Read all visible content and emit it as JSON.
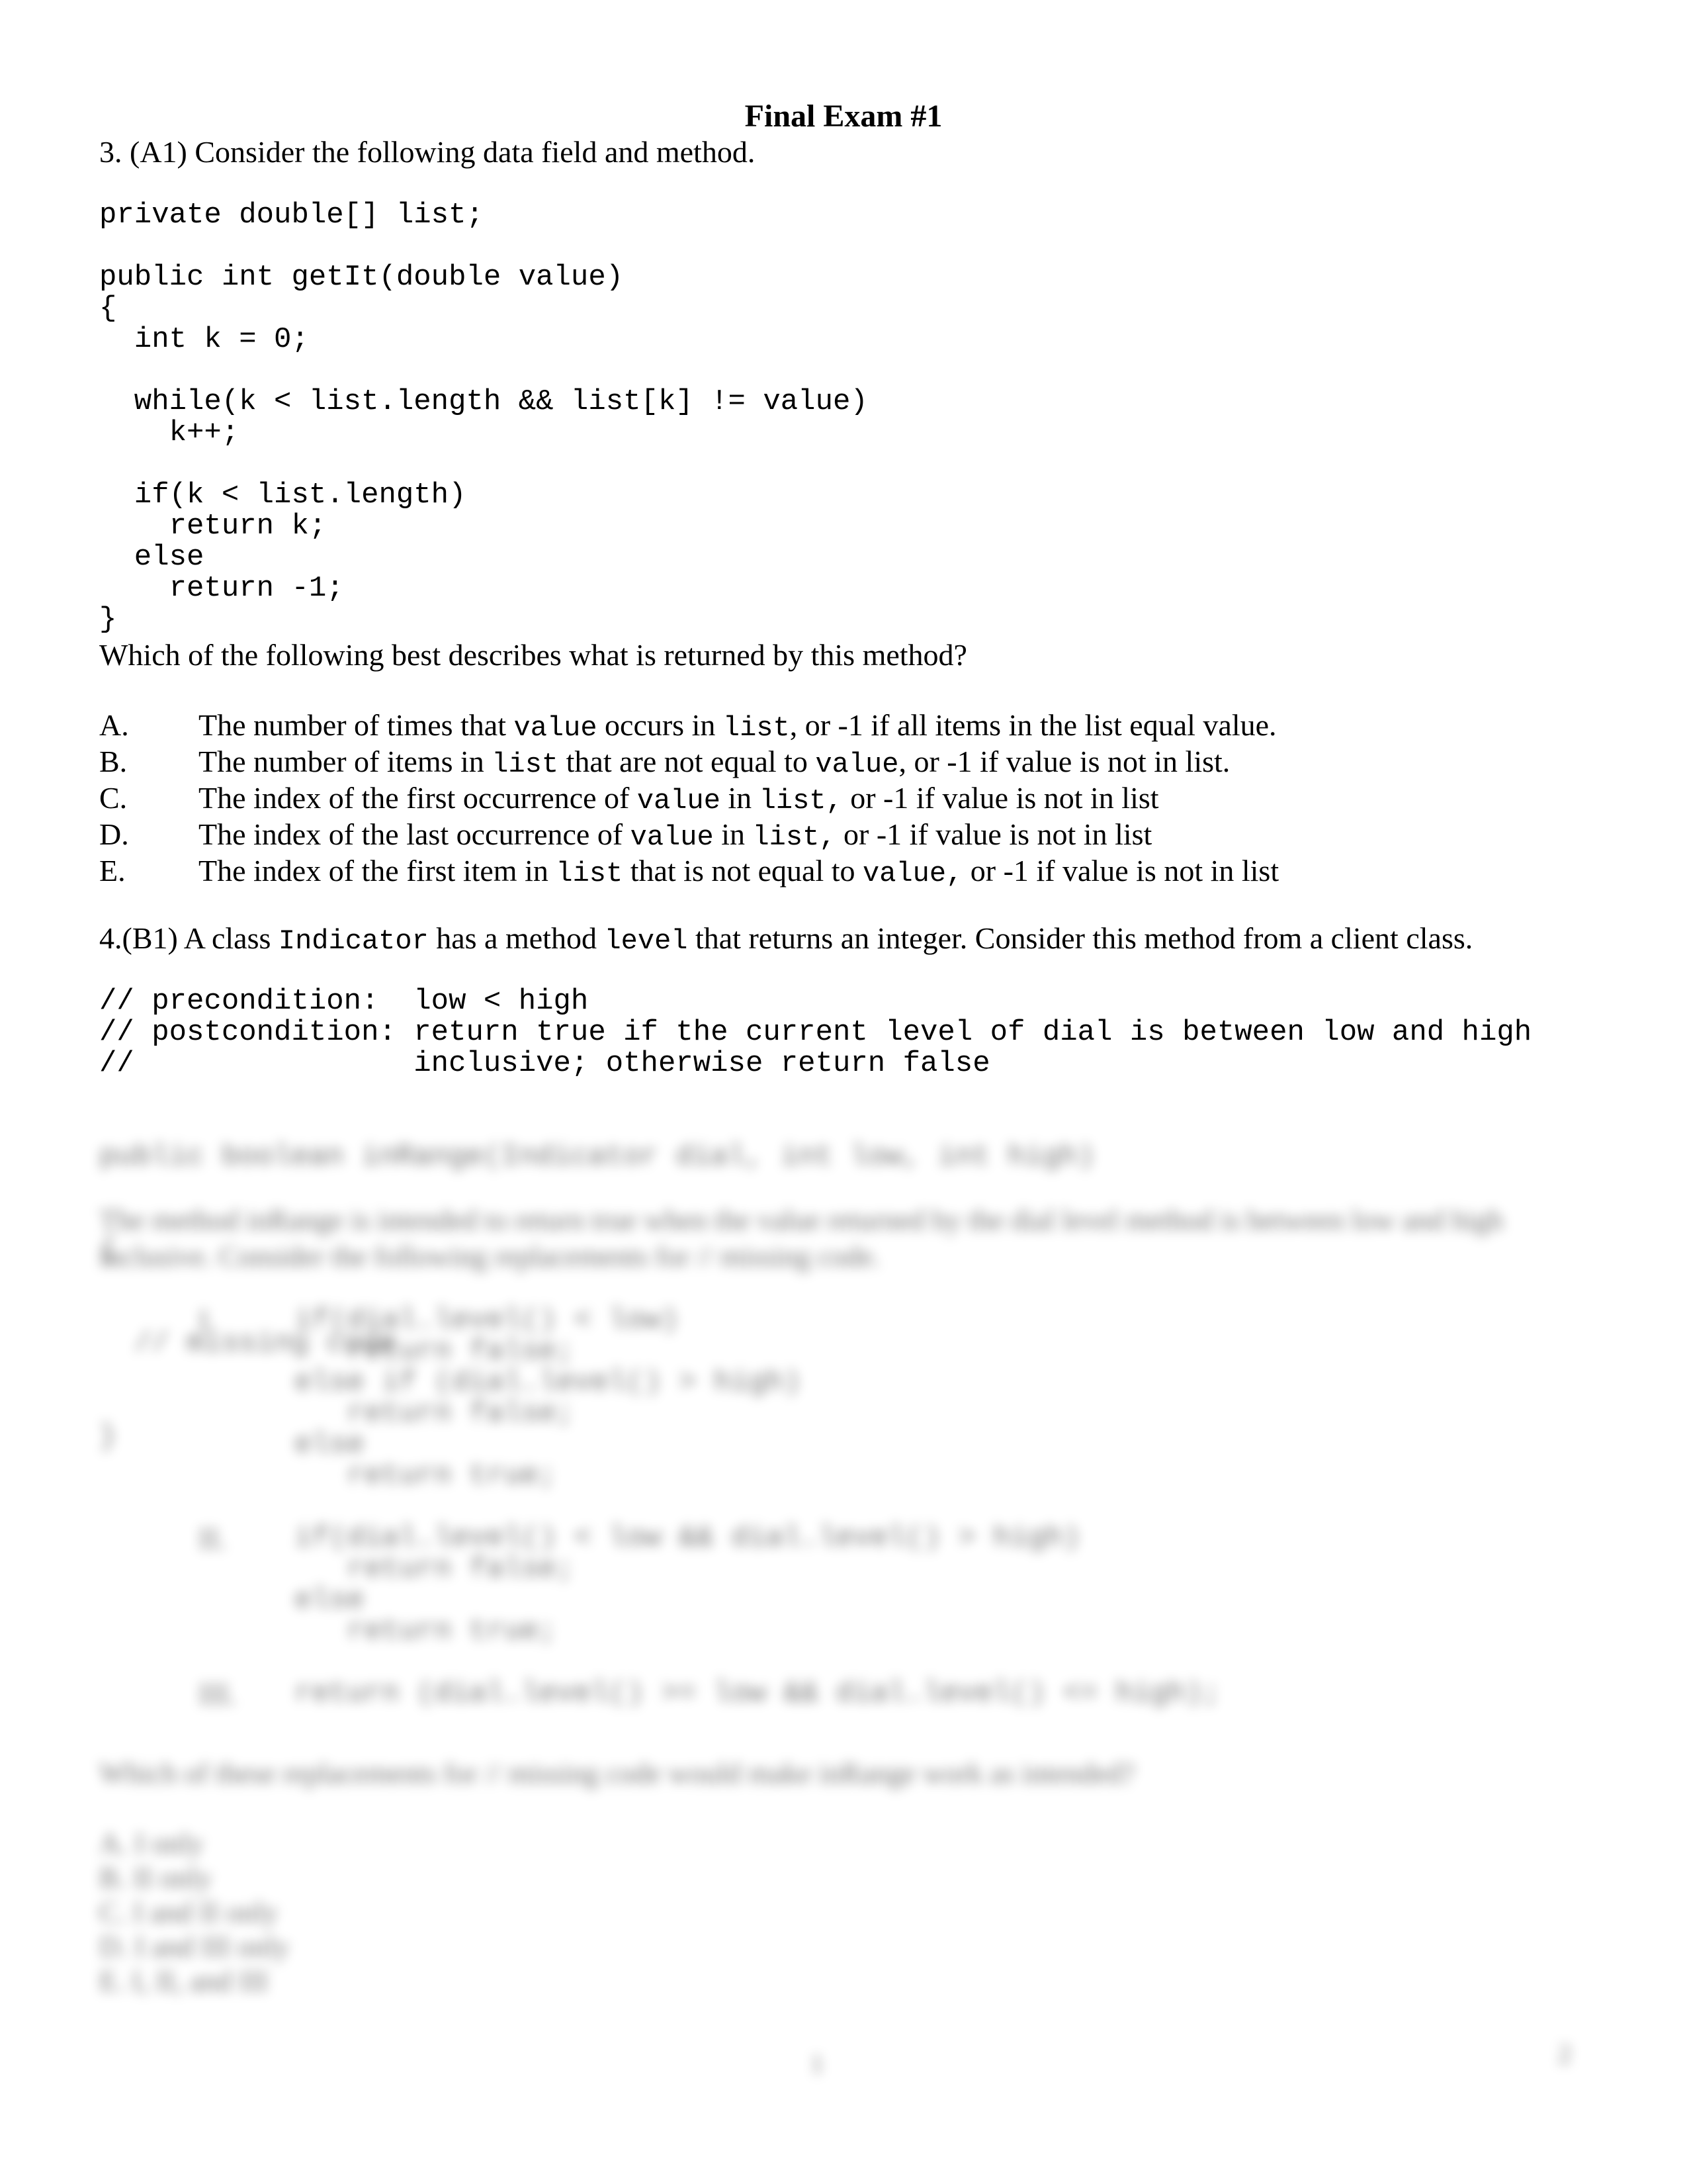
{
  "document": {
    "title": "Final Exam #1"
  },
  "q3": {
    "prompt": "3. (A1)  Consider the following data field and method.",
    "field_line": "private double[] list;",
    "code": [
      "public int getIt(double value)",
      "{",
      "  int k = 0;",
      "",
      "  while(k < list.length && list[k] != value)",
      "    k++;",
      "",
      "  if(k < list.length)",
      "    return k;",
      "  else",
      "    return -1;",
      "}"
    ],
    "question": "Which of the following best describes what is returned by this method?",
    "options": [
      {
        "letter": "A.",
        "parts": [
          {
            "t": "The number of times that ",
            "code": false
          },
          {
            "t": "value",
            "code": true
          },
          {
            "t": " occurs in ",
            "code": false
          },
          {
            "t": "list",
            "code": true
          },
          {
            "t": ", or -1 if all items in the list equal value.",
            "code": false
          }
        ]
      },
      {
        "letter": "B.",
        "parts": [
          {
            "t": "The number of items in ",
            "code": false
          },
          {
            "t": "list",
            "code": true
          },
          {
            "t": " that are not equal to ",
            "code": false
          },
          {
            "t": "value",
            "code": true
          },
          {
            "t": ", or -1 if value is not in list.",
            "code": false
          }
        ]
      },
      {
        "letter": "C.",
        "parts": [
          {
            "t": "The index of the first occurrence of ",
            "code": false
          },
          {
            "t": "value",
            "code": true
          },
          {
            "t": " in ",
            "code": false
          },
          {
            "t": "list,",
            "code": true
          },
          {
            "t": " or -1 if value is not in list",
            "code": false
          }
        ]
      },
      {
        "letter": "D.",
        "parts": [
          {
            "t": "The index of the last occurrence of ",
            "code": false
          },
          {
            "t": "value",
            "code": true
          },
          {
            "t": " in ",
            "code": false
          },
          {
            "t": "list,",
            "code": true
          },
          {
            "t": " or -1 if value is not in list",
            "code": false
          }
        ]
      },
      {
        "letter": "E.",
        "parts": [
          {
            "t": "The index of the first item in ",
            "code": false
          },
          {
            "t": "list",
            "code": true
          },
          {
            "t": " that is not equal to ",
            "code": false
          },
          {
            "t": "value,",
            "code": true
          },
          {
            "t": " or -1 if value is not in list",
            "code": false
          }
        ]
      }
    ]
  },
  "q4": {
    "prompt_parts": [
      {
        "t": "4.(B1) A class ",
        "code": false
      },
      {
        "t": "Indicator",
        "code": true
      },
      {
        "t": " has a method ",
        "code": false
      },
      {
        "t": "level",
        "code": true
      },
      {
        "t": " that returns an integer. Consider this method from a client class.",
        "code": false
      }
    ],
    "comments": [
      "// precondition:  low < high",
      "// postcondition: return true if the current level of dial is between low and high",
      "//                inclusive; otherwise return false"
    ],
    "blurred": {
      "signature": "public boolean inRange(Indicator dial, int low, int high)",
      "open_brace": "{",
      "missing": "  // missing code",
      "close_brace": "}",
      "description_1": "The method inRange is intended to return true when the value returned by the dial level method is between low and high",
      "description_2": "inclusive. Consider the following replacements for // missing code.",
      "items": [
        {
          "num": "I.",
          "lines": [
            "if(dial.level() < low)",
            "   return false;",
            "else if (dial.level() > high)",
            "   return false;",
            "else",
            "   return true;"
          ]
        },
        {
          "num": "II.",
          "lines": [
            "if(dial.level() < low && dial.level() > high)",
            "   return false;",
            "else",
            "   return true;"
          ]
        },
        {
          "num": "III.",
          "lines": [
            "return (dial.level() >= low && dial.level() <= high);"
          ]
        }
      ],
      "question": "Which of these replacements for // missing code would make inRange work as intended?",
      "answers": [
        "A. I only",
        "B. II only",
        "C. I and II only",
        "D. I and III only",
        "E. I, II, and III"
      ]
    }
  },
  "footer": {
    "center": "1",
    "right": "2"
  }
}
